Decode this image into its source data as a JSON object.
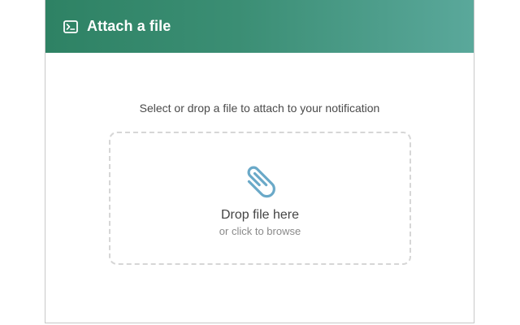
{
  "dialog": {
    "title": "Attach a file",
    "title_icon": "terminal-icon",
    "instruction": "Select or drop a file to attach to your notification",
    "dropzone": {
      "icon": "paperclip-icon",
      "title": "Drop file here",
      "subtitle": "or click to browse"
    }
  },
  "colors": {
    "header_start": "#2e8264",
    "header_end": "#5aa89b",
    "icon_blue": "#6aa9c8",
    "dashed_border": "#d6d6d6"
  }
}
